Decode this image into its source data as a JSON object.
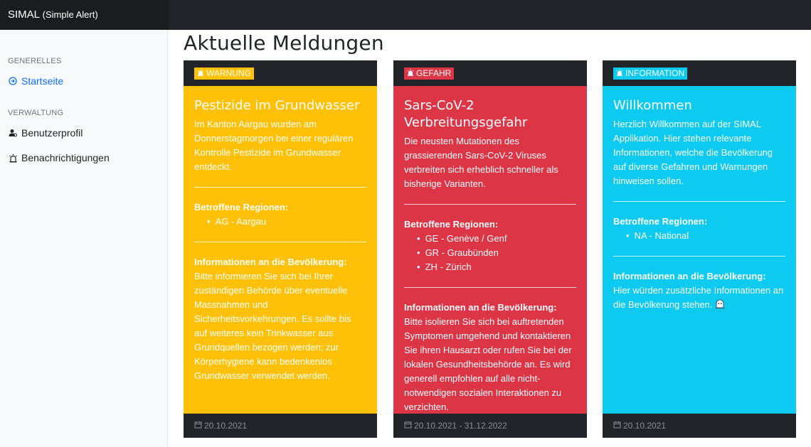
{
  "app": {
    "brand": "SIMAL",
    "brand_sub": "(Simple Alert)"
  },
  "sidebar": {
    "section1": "GENERELLES",
    "startseite": "Startseite",
    "section2": "VERWALTUNG",
    "benutzerprofil": "Benutzerprofil",
    "benachrichtigungen": "Benachrichtigungen"
  },
  "main": {
    "title": "Aktuelle Meldungen"
  },
  "colors": {
    "warnung": "#ffc107",
    "gefahr": "#dc3545",
    "information": "#0dcaf0",
    "link": "#0d6efd"
  },
  "cards": [
    {
      "badge": "WARNUNG",
      "title": "Pestizide im Grundwasser",
      "text": "Im Kanton Aargau wurden am Donnerstagmorgen bei einer regulären Kontrolle Pestizide im Grundwasser entdeckt.",
      "regions_label": "Betroffene Regionen:",
      "regions": [
        "AG - Aargau"
      ],
      "info_label": "Informationen an die Bevölkerung:",
      "info": "Bitte informieren Sie sich bei Ihrer zuständigen Behörde über eventuelle Massnahmen und Sicherheitsvorkehrungen. Es sollte bis auf weiteres kein Trinkwasser aus Grundquellen bezogen werden; zur Körperhygiene kann bedenkenlos Grundwasser verwendet werden.",
      "date": "20.10.2021"
    },
    {
      "badge": "GEFAHR",
      "title": "Sars-CoV-2 Verbreitungsgefahr",
      "text": "Die neusten Mutationen des grassierenden Sars-CoV-2 Viruses verbreiten sich erheblich schneller als bisherige Varianten.",
      "regions_label": "Betroffene Regionen:",
      "regions": [
        "GE - Genève / Genf",
        "GR - Graubünden",
        "ZH - Zürich"
      ],
      "info_label": "Informationen an die Bevölkerung:",
      "info": "Bitte isolieren Sie sich bei auftretenden Symptomen umgehend und kontaktieren Sie ihren Hausarzt oder rufen Sie bei der lokalen Gesundheitsbehörde an. Es wird generell empfohlen auf alle nicht-notwendigen sozialen Interaktionen zu verzichten.",
      "date": "20.10.2021 - 31.12.2022"
    },
    {
      "badge": "INFORMATION",
      "title": "Willkommen",
      "text": "Herzlich Willkommen auf der SIMAL Applikation. Hier stehen relevante Informationen, welche die Bevölkerung auf diverse Gefahren und Warnungen hinweisen sollen.",
      "regions_label": "Betroffene Regionen:",
      "regions": [
        "NA - National"
      ],
      "info_label": "Informationen an die Bevölkerung:",
      "info": "Hier würden zusätzliche Informationen an die Bevölkerung stehen.",
      "date": "20.10.2021"
    }
  ]
}
